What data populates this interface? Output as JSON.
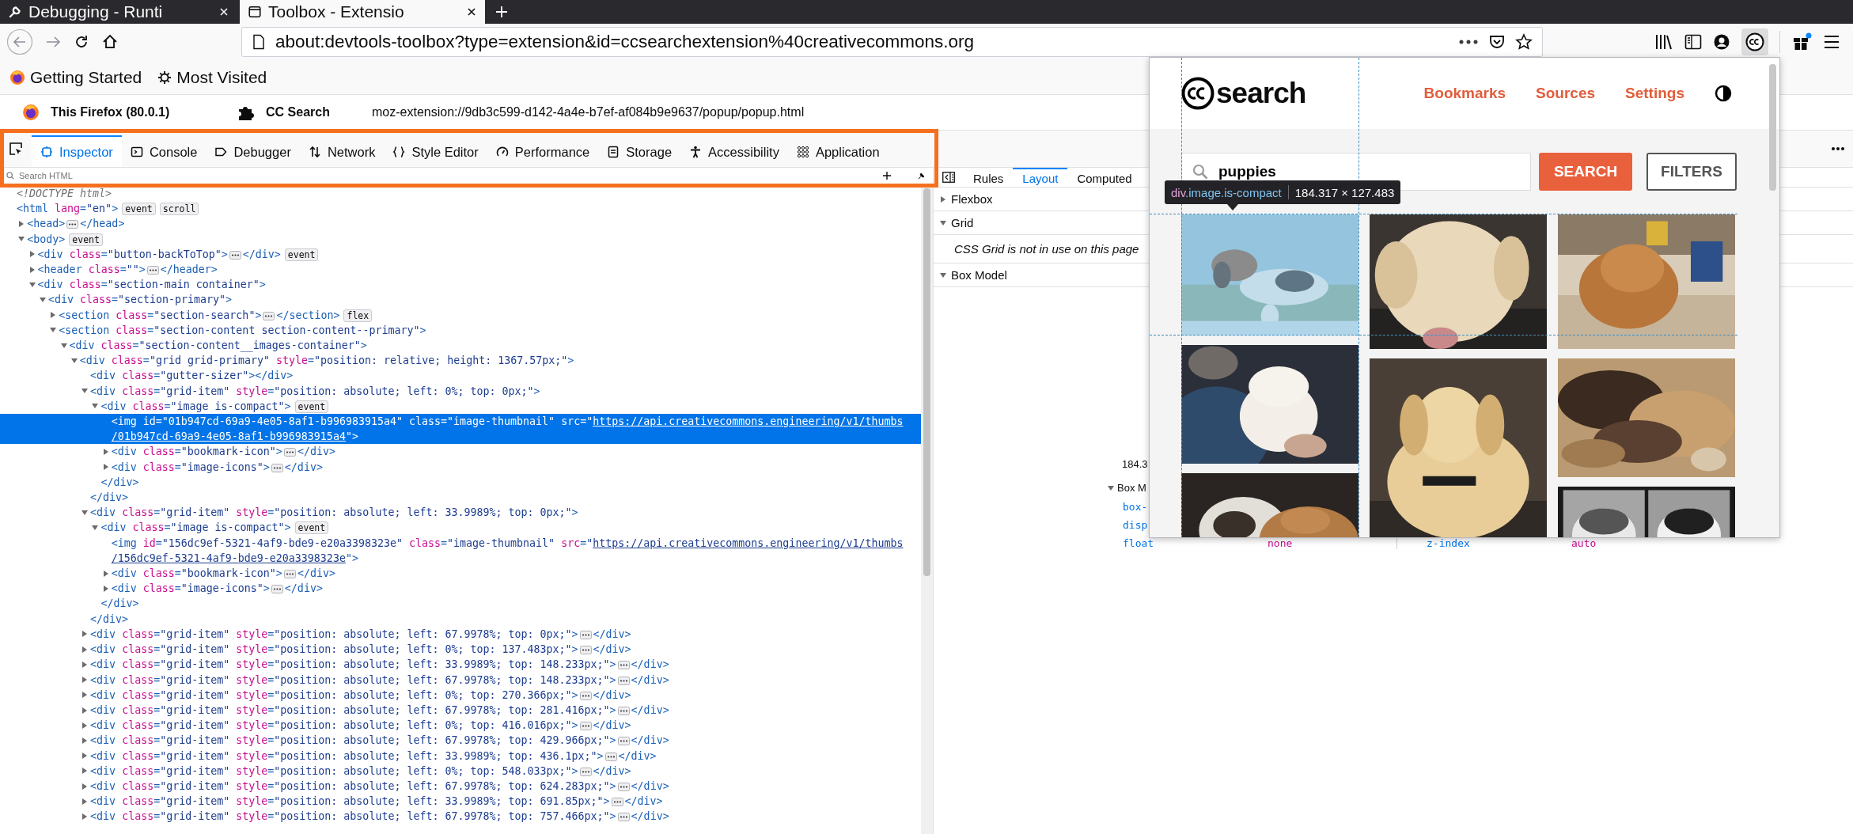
{
  "browser": {
    "tabs": [
      {
        "title": "Debugging - Runti",
        "selected": false
      },
      {
        "title": "Toolbox - Extensio",
        "selected": true
      }
    ],
    "url": "about:devtools-toolbox?type=extension&id=ccsearchextension%40creativecommons.org",
    "bookmarks": [
      "Getting Started",
      "Most Visited"
    ]
  },
  "target": {
    "browser": "This Firefox (80.0.1)",
    "extension": "CC Search",
    "url": "moz-extension://9db3c599-d142-4a4e-b7ef-af084b9e9637/popup/popup.html"
  },
  "devtools": {
    "tools": [
      {
        "label": "Inspector",
        "selected": true
      },
      {
        "label": "Console",
        "selected": false
      },
      {
        "label": "Debugger",
        "selected": false
      },
      {
        "label": "Network",
        "selected": false
      },
      {
        "label": "Style Editor",
        "selected": false
      },
      {
        "label": "Performance",
        "selected": false
      },
      {
        "label": "Storage",
        "selected": false
      },
      {
        "label": "Accessibility",
        "selected": false
      },
      {
        "label": "Application",
        "selected": false
      }
    ],
    "search_placeholder": "Search HTML"
  },
  "markup": {
    "doctype": "<!DOCTYPE html>",
    "tree": [
      {
        "open": "<html lang=\"en\">",
        "badges": [
          "event",
          "scroll"
        ],
        "selected": false,
        "children": [
          {
            "open": "<head>",
            "close": "</head>",
            "expanded": false,
            "selected": false
          },
          {
            "open": "<body>",
            "badges": [
              "event"
            ],
            "expanded": true,
            "selected": false,
            "children": [
              {
                "open": "<div class=\"button-backToTop\">",
                "close": "</div>",
                "expanded": false,
                "badges": [
                  "event"
                ],
                "selected": false
              },
              {
                "open": "<header class=\"\">",
                "close": "</header>",
                "expanded": false,
                "selected": false
              },
              {
                "open": "<div class=\"section-main container\">",
                "expanded": true,
                "selected": false,
                "children": [
                  {
                    "open": "<div class=\"section-primary\">",
                    "expanded": true,
                    "selected": false,
                    "children": [
                      {
                        "open": "<section class=\"section-search\">",
                        "close": "</section>",
                        "expanded": false,
                        "badges": [
                          "flex"
                        ],
                        "selected": false
                      },
                      {
                        "open": "<section class=\"section-content section-content--primary\">",
                        "expanded": true,
                        "selected": false,
                        "children": [
                          {
                            "open": "<div class=\"section-content__images-container\">",
                            "expanded": true,
                            "selected": false,
                            "children": [
                              {
                                "open": "<div class=\"grid grid-primary\" style=\"position: relative; height: 1367.57px;\">",
                                "expanded": true,
                                "selected": false,
                                "children": [
                                  {
                                    "open": "<div class=\"gutter-sizer\"></div>",
                                    "selected": false
                                  },
                                  {
                                    "open": "<div class=\"grid-item\" style=\"position: absolute; left: 0%; top: 0px;\">",
                                    "close": "</div>",
                                    "expanded": true,
                                    "selected": false,
                                    "children": [
                                      {
                                        "open": "<div class=\"image is-compact\">",
                                        "close": "</div>",
                                        "expanded": true,
                                        "badges": [
                                          "event"
                                        ],
                                        "selected": false,
                                        "children": [
                                          {
                                            "open": [
                                              "<img id=\"01b947cd-69a9-4e05-8af1-b996983915a4\" class=\"image-thumbnail\" src=\"https://api.creativecommons.engineering/v1/thumbs",
                                              "/01b947cd-69a9-4e05-8af1-b996983915a4\">"
                                            ],
                                            "selected": true
                                          },
                                          {
                                            "open": "<div class=\"bookmark-icon\">",
                                            "close": "</div>",
                                            "expanded": false,
                                            "selected": false
                                          },
                                          {
                                            "open": "<div class=\"image-icons\">",
                                            "close": "</div>",
                                            "expanded": false,
                                            "selected": false
                                          }
                                        ]
                                      }
                                    ]
                                  },
                                  {
                                    "open": "<div class=\"grid-item\" style=\"position: absolute; left: 33.9989%; top: 0px;\">",
                                    "close": "</div>",
                                    "expanded": true,
                                    "selected": false,
                                    "children": [
                                      {
                                        "open": "<div class=\"image is-compact\">",
                                        "close": "</div>",
                                        "expanded": true,
                                        "badges": [
                                          "event"
                                        ],
                                        "selected": false,
                                        "children": [
                                          {
                                            "open": [
                                              "<img id=\"156dc9ef-5321-4af9-bde9-e20a3398323e\" class=\"image-thumbnail\" src=\"https://api.creativecommons.engineering/v1/thumbs",
                                              "/156dc9ef-5321-4af9-bde9-e20a3398323e\">"
                                            ],
                                            "selected": false
                                          },
                                          {
                                            "open": "<div class=\"bookmark-icon\">",
                                            "close": "</div>",
                                            "expanded": false,
                                            "selected": false
                                          },
                                          {
                                            "open": "<div class=\"image-icons\">",
                                            "close": "</div>",
                                            "expanded": false,
                                            "selected": false
                                          }
                                        ]
                                      }
                                    ]
                                  },
                                  {
                                    "open": "<div class=\"grid-item\" style=\"position: absolute; left: 67.9978%; top: 0px;\">",
                                    "close": "</div>",
                                    "expanded": false,
                                    "selected": false
                                  },
                                  {
                                    "open": "<div class=\"grid-item\" style=\"position: absolute; left: 0%; top: 137.483px;\">",
                                    "close": "</div>",
                                    "expanded": false,
                                    "selected": false
                                  },
                                  {
                                    "open": "<div class=\"grid-item\" style=\"position: absolute; left: 33.9989%; top: 148.233px;\">",
                                    "close": "</div>",
                                    "expanded": false,
                                    "selected": false
                                  },
                                  {
                                    "open": "<div class=\"grid-item\" style=\"position: absolute; left: 67.9978%; top: 148.233px;\">",
                                    "close": "</div>",
                                    "expanded": false,
                                    "selected": false
                                  },
                                  {
                                    "open": "<div class=\"grid-item\" style=\"position: absolute; left: 0%; top: 270.366px;\">",
                                    "close": "</div>",
                                    "expanded": false,
                                    "selected": false
                                  },
                                  {
                                    "open": "<div class=\"grid-item\" style=\"position: absolute; left: 67.9978%; top: 281.416px;\">",
                                    "close": "</div>",
                                    "expanded": false,
                                    "selected": false
                                  },
                                  {
                                    "open": "<div class=\"grid-item\" style=\"position: absolute; left: 0%; top: 416.016px;\">",
                                    "close": "</div>",
                                    "expanded": false,
                                    "selected": false
                                  },
                                  {
                                    "open": "<div class=\"grid-item\" style=\"position: absolute; left: 67.9978%; top: 429.966px;\">",
                                    "close": "</div>",
                                    "expanded": false,
                                    "selected": false
                                  },
                                  {
                                    "open": "<div class=\"grid-item\" style=\"position: absolute; left: 33.9989%; top: 436.1px;\">",
                                    "close": "</div>",
                                    "expanded": false,
                                    "selected": false
                                  },
                                  {
                                    "open": "<div class=\"grid-item\" style=\"position: absolute; left: 0%; top: 548.033px;\">",
                                    "close": "</div>",
                                    "expanded": false,
                                    "selected": false
                                  },
                                  {
                                    "open": "<div class=\"grid-item\" style=\"position: absolute; left: 67.9978%; top: 624.283px;\">",
                                    "close": "</div>",
                                    "expanded": false,
                                    "selected": false
                                  },
                                  {
                                    "open": "<div class=\"grid-item\" style=\"position: absolute; left: 33.9989%; top: 691.85px;\">",
                                    "close": "</div>",
                                    "expanded": false,
                                    "selected": false
                                  },
                                  {
                                    "open": "<div class=\"grid-item\" style=\"position: absolute; left: 67.9978%; top: 757.466px;\">",
                                    "close": "</div>",
                                    "expanded": false,
                                    "selected": false
                                  }
                                ]
                              }
                            ]
                          }
                        ]
                      }
                    ]
                  }
                ]
              }
            ]
          }
        ]
      }
    ]
  },
  "sidebar": {
    "tabs": [
      {
        "label": "Rules",
        "selected": false
      },
      {
        "label": "Layout",
        "selected": true
      },
      {
        "label": "Computed",
        "selected": false
      }
    ],
    "sections": [
      {
        "title": "Flexbox",
        "expanded": false
      },
      {
        "title": "Grid",
        "expanded": true,
        "note": "CSS Grid is not in use on this page"
      },
      {
        "title": "Box Model",
        "expanded": true
      }
    ],
    "box_model": {
      "size": "184.3",
      "title": "Box M",
      "rows": [
        [
          {
            "name": "box-"
          }
        ],
        [
          {
            "name": "disp"
          }
        ],
        [
          {
            "name": "float",
            "value": "none"
          },
          {
            "name": "z-index",
            "value": "auto"
          }
        ]
      ]
    }
  },
  "popup": {
    "logo_text": "search",
    "nav": [
      "Bookmarks",
      "Sources",
      "Settings"
    ],
    "query": "puppies",
    "search_button": "SEARCH",
    "filters_button": "FILTERS",
    "tooltip": {
      "selector": "div.image.is-compact",
      "size": "184.317 × 127.483"
    }
  }
}
